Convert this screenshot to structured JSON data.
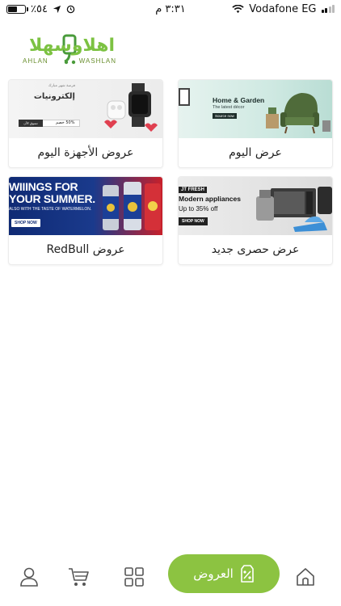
{
  "status_bar": {
    "battery_percent": "٪٥٤",
    "battery_level": 0.54,
    "time": "٣:٣١ م",
    "carrier": "Vodafone EG",
    "icons": [
      "battery-icon",
      "location-arrow-icon",
      "alarm-icon",
      "wifi-icon",
      "signal-icon"
    ]
  },
  "logo": {
    "arabic": "اهلاوسهلا",
    "en_left": "AHLAN",
    "en_right": "WASHLAN"
  },
  "offers": [
    {
      "label": "عرض اليوم",
      "banner": {
        "title": "Home & Garden",
        "subtitle": "The latest décor",
        "button": "Source now"
      }
    },
    {
      "label": "عروض الأجهزة اليوم",
      "banner": {
        "small": "فرصة شهر مبارك",
        "title": "إلكترونيات",
        "button": "تسوق الآن",
        "discount": "50% خصم"
      }
    },
    {
      "label": "عرض حصرى جديد",
      "banner": {
        "tag": "JT FRESH",
        "title": "Modern appliances",
        "subtitle": "Up to 35% off",
        "button": "SHOP NOW"
      }
    },
    {
      "label": "عروض RedBull",
      "banner": {
        "title_line1": "WIIINGS FOR",
        "title_line2": "YOUR SUMMER.",
        "subtitle": "ALSO WITH THE TASTE OF WATERMELON.",
        "button": "SHOP NOW"
      }
    }
  ],
  "bottom_nav": {
    "offers_label": "العروض",
    "items": [
      "profile-icon",
      "cart-icon",
      "categories-icon",
      "offers-icon",
      "home-icon"
    ],
    "accent_color": "#8cc341"
  },
  "colors": {
    "brand_green": "#7cc242",
    "nav_active": "#8cc341"
  }
}
